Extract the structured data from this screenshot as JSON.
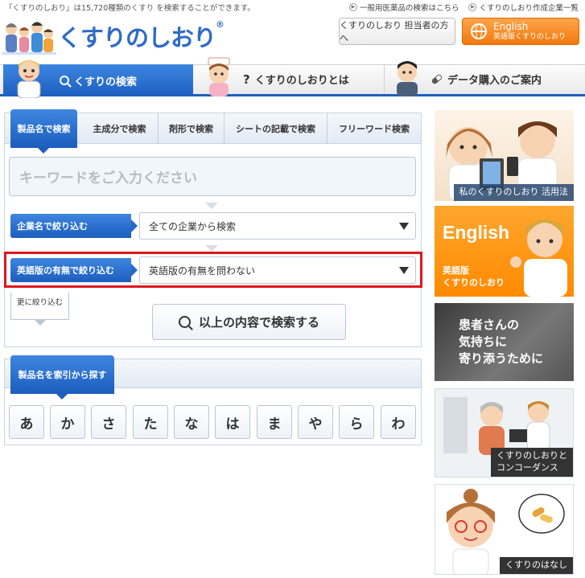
{
  "header": {
    "tagline": "「くすりのしおり」は15,720種類のくすり を検索することができます。",
    "links": [
      {
        "label": "一般用医薬品の検索はこちら"
      },
      {
        "label": "くすりのしおり作成企業一覧"
      }
    ],
    "logo_text": "くすりのしおり",
    "logo_mark": "®",
    "staff_button": "くすりのしおり 担当者の方へ",
    "english_button": {
      "line1": "English",
      "line2": "英語版くすりのしおり"
    }
  },
  "nav": {
    "items": [
      {
        "label": "くすりの検索",
        "icon": "search-icon",
        "active": true
      },
      {
        "label": "くすりのしおりとは",
        "icon": "question-icon"
      },
      {
        "label": "データ購入のご案内",
        "icon": "pill-icon"
      }
    ]
  },
  "search": {
    "tabs": [
      "製品名で検索",
      "主成分で検索",
      "剤形で検索",
      "シートの記載で検索",
      "フリーワード検索"
    ],
    "keyword_placeholder": "キーワードをご入力ください",
    "company_filter": {
      "label": "企業名で絞り込む",
      "value": "全ての企業から検索"
    },
    "english_filter": {
      "label": "英語版の有無で絞り込む",
      "value": "英語版の有無を問わない"
    },
    "more_filters": "更に絞り込む",
    "submit_label": "以上の内容で検索する"
  },
  "index": {
    "title": "製品名を索引から探す",
    "kana": [
      "あ",
      "か",
      "さ",
      "た",
      "な",
      "は",
      "ま",
      "や",
      "ら",
      "わ"
    ]
  },
  "banners": {
    "b1_caption": "私のくすりのしおり 活用法",
    "b2_title": "English",
    "b2_line1": "英語版",
    "b2_line2": "くすりのしおり",
    "b3_line1": "患者さんの",
    "b3_line2": "気持ちに",
    "b3_line3": "寄り添うために",
    "b4_line1": "くすりのしおりと",
    "b4_line2": "コンコーダンス",
    "b5_caption": "くすりのはなし"
  },
  "colors": {
    "accent_blue": "#1d5fc0",
    "orange": "#f07a0e",
    "highlight_red": "#e0161e"
  }
}
